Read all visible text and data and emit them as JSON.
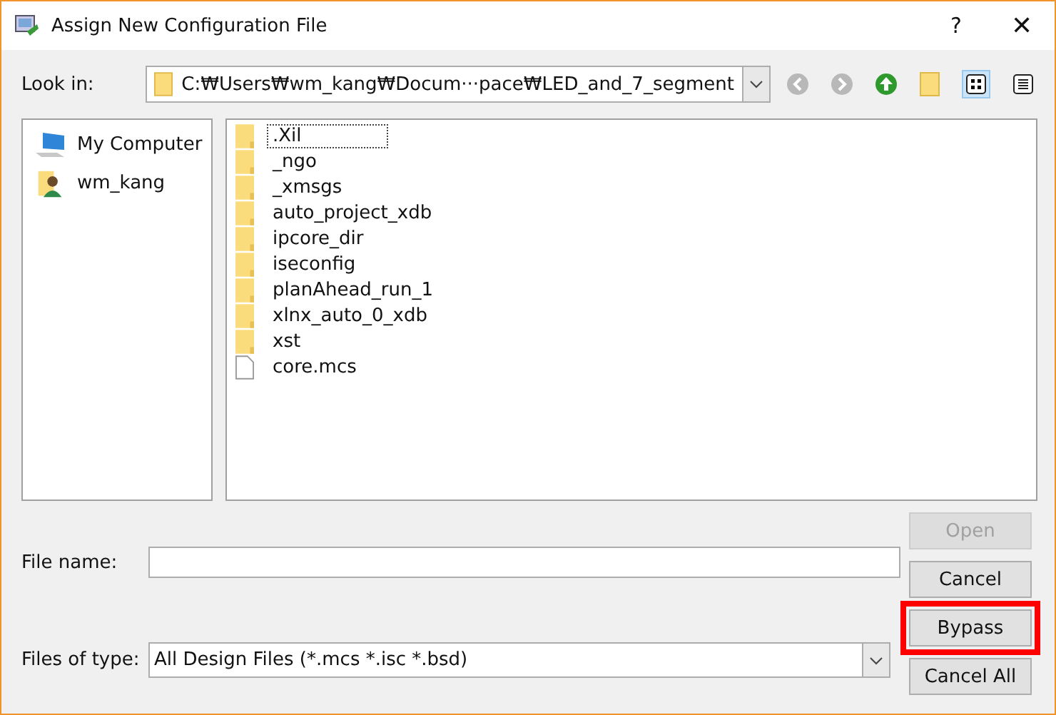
{
  "window": {
    "title": "Assign New Configuration File",
    "help": "?",
    "close": "✕"
  },
  "look_in": {
    "label": "Look in:",
    "path": "C:₩Users₩wm_kang₩Docum···pace₩LED_and_7_segment"
  },
  "toolbar": [
    {
      "kind": "back",
      "disabled": true
    },
    {
      "kind": "forward",
      "disabled": true
    },
    {
      "kind": "up",
      "disabled": false
    },
    {
      "kind": "newfolder",
      "disabled": false
    },
    {
      "kind": "list",
      "selected": true
    },
    {
      "kind": "details",
      "selected": false
    }
  ],
  "places": [
    {
      "kind": "computer",
      "label": "My Computer"
    },
    {
      "kind": "user",
      "label": "wm_kang"
    }
  ],
  "files": [
    {
      "kind": "folder",
      "name": ".Xil",
      "selected": true
    },
    {
      "kind": "folder",
      "name": "_ngo",
      "selected": false
    },
    {
      "kind": "folder",
      "name": "_xmsgs",
      "selected": false
    },
    {
      "kind": "folder",
      "name": "auto_project_xdb",
      "selected": false
    },
    {
      "kind": "folder",
      "name": "ipcore_dir",
      "selected": false
    },
    {
      "kind": "folder",
      "name": "iseconfig",
      "selected": false
    },
    {
      "kind": "folder",
      "name": "planAhead_run_1",
      "selected": false
    },
    {
      "kind": "folder",
      "name": "xlnx_auto_0_xdb",
      "selected": false
    },
    {
      "kind": "folder",
      "name": "xst",
      "selected": false
    },
    {
      "kind": "file",
      "name": "core.mcs",
      "selected": false
    }
  ],
  "file_name": {
    "label": "File name:"
  },
  "file_type": {
    "label": "Files of type:",
    "value": "All Design Files (*.mcs *.isc *.bsd)"
  },
  "buttons": [
    {
      "label": "Open",
      "disabled": true,
      "highlighted": false
    },
    {
      "label": "Cancel",
      "disabled": false,
      "highlighted": false
    },
    {
      "label": "Bypass",
      "disabled": false,
      "highlighted": true
    },
    {
      "label": "Cancel All",
      "disabled": false,
      "highlighted": false
    }
  ]
}
